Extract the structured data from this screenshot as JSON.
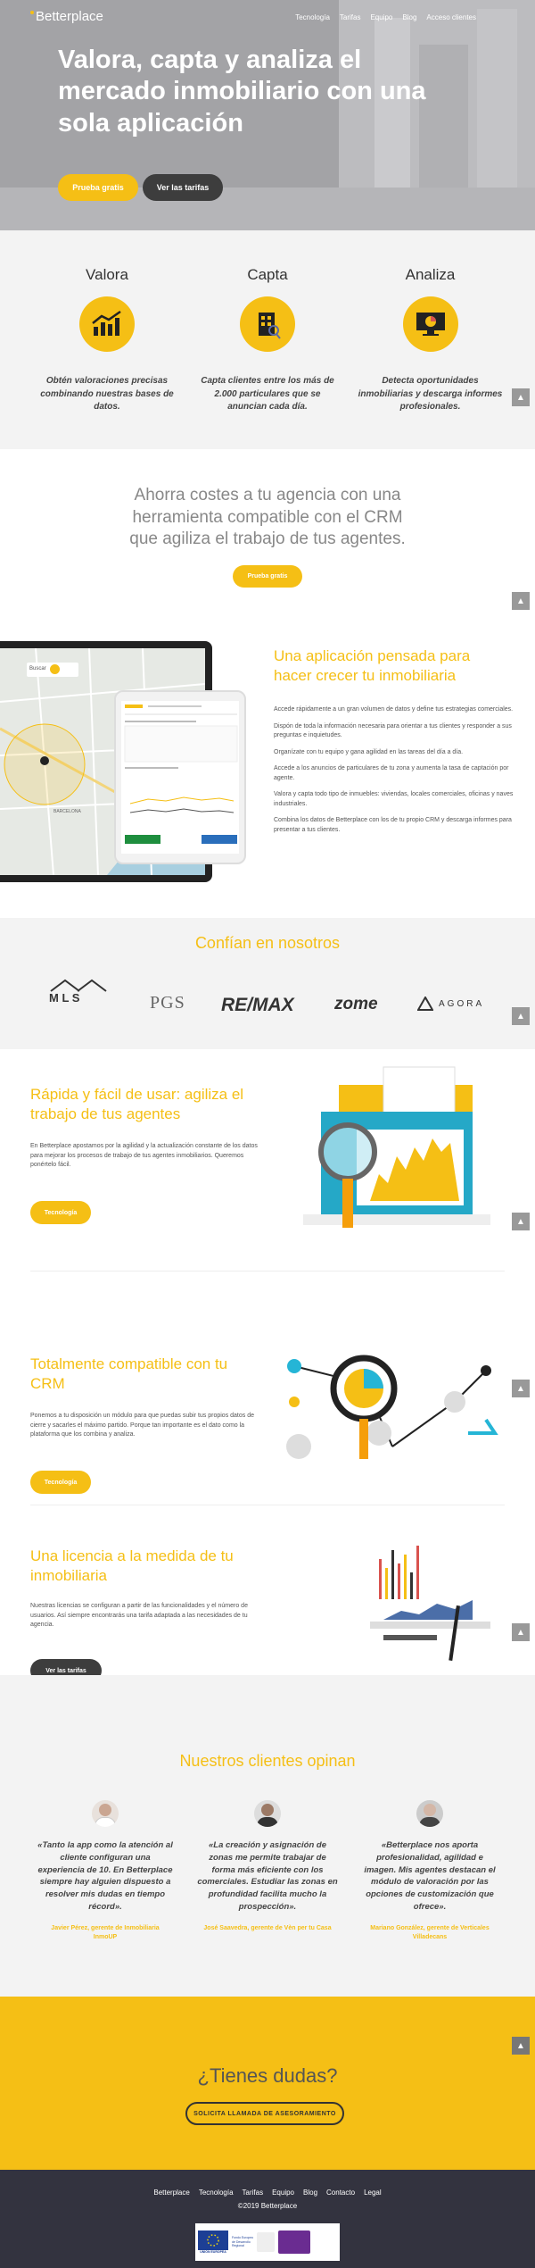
{
  "header": {
    "logo": "Betterplace",
    "nav": [
      "Tecnología",
      "Tarifas",
      "Equipo",
      "Blog",
      "Acceso clientes"
    ]
  },
  "hero": {
    "title_l1": "Valora, capta y analiza el",
    "title_l2": "mercado inmobiliario con una",
    "title_l3": "sola aplicación",
    "btn_trial": "Prueba gratis",
    "btn_rates": "Ver las tarifas"
  },
  "features": [
    {
      "title": "Valora",
      "text_l1": "Obtén valoraciones precisas",
      "text_l2": "combinando nuestras bases de",
      "text_l3": "datos.",
      "icon": "chart-up-icon"
    },
    {
      "title": "Capta",
      "text_l1": "Capta clientes entre los más de",
      "text_l2": "2.000 particulares que se",
      "text_l3": "anuncian cada día.",
      "icon": "building-magnifier-icon"
    },
    {
      "title": "Analiza",
      "text_l1": "Detecta oportunidades",
      "text_l2": "inmobiliarias y descarga informes",
      "text_l3": "profesionales.",
      "icon": "monitor-pie-icon"
    }
  ],
  "savings": {
    "l1": "Ahorra costes a tu agencia con una",
    "l2": "herramienta compatible con el CRM",
    "l3": "que agiliza el trabajo de tus agentes.",
    "btn": "Prueba gratis"
  },
  "app": {
    "title_l1": "Una aplicación pensada para",
    "title_l2": "hacer crecer tu inmobiliaria",
    "paragraphs": [
      "Accede rápidamente a un gran volumen de datos y define tus estrategias comerciales.",
      "Dispón de toda la información necesaria para orientar a tus clientes y responder a sus preguntas e inquietudes.",
      "Organízate con tu equipo y gana agilidad en las tareas del día a día.",
      "Accede a los anuncios de particulares de tu zona y aumenta la tasa de captación por agente.",
      "Valora y capta todo tipo de inmuebles: viviendas, locales comerciales, oficinas y naves industriales.",
      "Combina los datos de Betterplace con los de tu propio CRM y descarga informes para presentar a tus clientes."
    ],
    "map_search": "Buscar",
    "map_label": "BARCELONA"
  },
  "trust": {
    "title": "Confían en nosotros",
    "logos": [
      "M L S",
      "PGS",
      "RE/MAX",
      "zome",
      "AGORA"
    ]
  },
  "fast": {
    "title_l1": "Rápida y fácil de usar: agiliza el",
    "title_l2": "trabajo de tus agentes",
    "text": "En Betterplace apostamos por la agilidad y la actualización constante de los datos para mejorar los procesos de trabajo de tus agentes inmobiliarios. Queremos ponértelo fácil.",
    "btn": "Tecnología"
  },
  "crm": {
    "title_l1": "Totalmente compatible con tu",
    "title_l2": "CRM",
    "text": "Ponemos a tu disposición un módulo para que puedas subir tus propios datos de cierre y sacarles el máximo partido. Porque tan importante es el dato como la plataforma que los combina y analiza.",
    "btn": "Tecnología"
  },
  "license": {
    "title_l1": "Una licencia a la medida de tu",
    "title_l2": "inmobiliaria",
    "text": "Nuestras licencias se configuran a partir de las funcionalidades y el número de usuarios. Así siempre encontrarás una tarifa adaptada a las necesidades de tu agencia.",
    "btn": "Ver las tarifas"
  },
  "testimonials": {
    "title": "Nuestros clientes opinan",
    "items": [
      {
        "q1": "«Tanto la app como la atención al",
        "q2": "cliente configuran una",
        "q3": "experiencia de 10. En Betterplace",
        "q4": "siempre hay alguien dispuesto a",
        "q5": "resolver mis dudas en tiempo",
        "q6": "récord».",
        "a1": "Javier Pérez, gerente de Inmobiliaria",
        "a2": "InmoUP"
      },
      {
        "q1": "«La creación y asignación de",
        "q2": "zonas me permite trabajar de",
        "q3": "forma más eficiente con los",
        "q4": "comerciales. Estudiar las zonas en",
        "q5": "profundidad facilita mucho la",
        "q6": "prospección».",
        "a1": "José Saavedra, gerente de Vèn per tu Casa",
        "a2": ""
      },
      {
        "q1": "«Betterplace nos aporta",
        "q2": "profesionalidad, agilidad e",
        "q3": "imagen. Mis agentes destacan el",
        "q4": "módulo de valoración por las",
        "q5": "opciones de customización que",
        "q6": "ofrece».",
        "a1": "Mariano González, gerente de Verticales",
        "a2": "Villadecans"
      }
    ]
  },
  "questions": {
    "title": "¿Tienes dudas?",
    "btn": "SOLICITA LLAMADA DE ASESORAMIENTO"
  },
  "footer": {
    "links": [
      "Betterplace",
      "Tecnología",
      "Tarifas",
      "Equipo",
      "Blog",
      "Contacto",
      "Legal"
    ],
    "copyright": "©2019 Betterplace",
    "eu_l1": "UNIÓN EUROPEA",
    "eu_fund_l1": "Fondo Europeo",
    "eu_fund_l2": "de Desarrollo",
    "eu_fund_l3": "Regional"
  },
  "colors": {
    "accent": "#f5bf15",
    "dark": "#33333f",
    "light": "#f3f3f3"
  }
}
